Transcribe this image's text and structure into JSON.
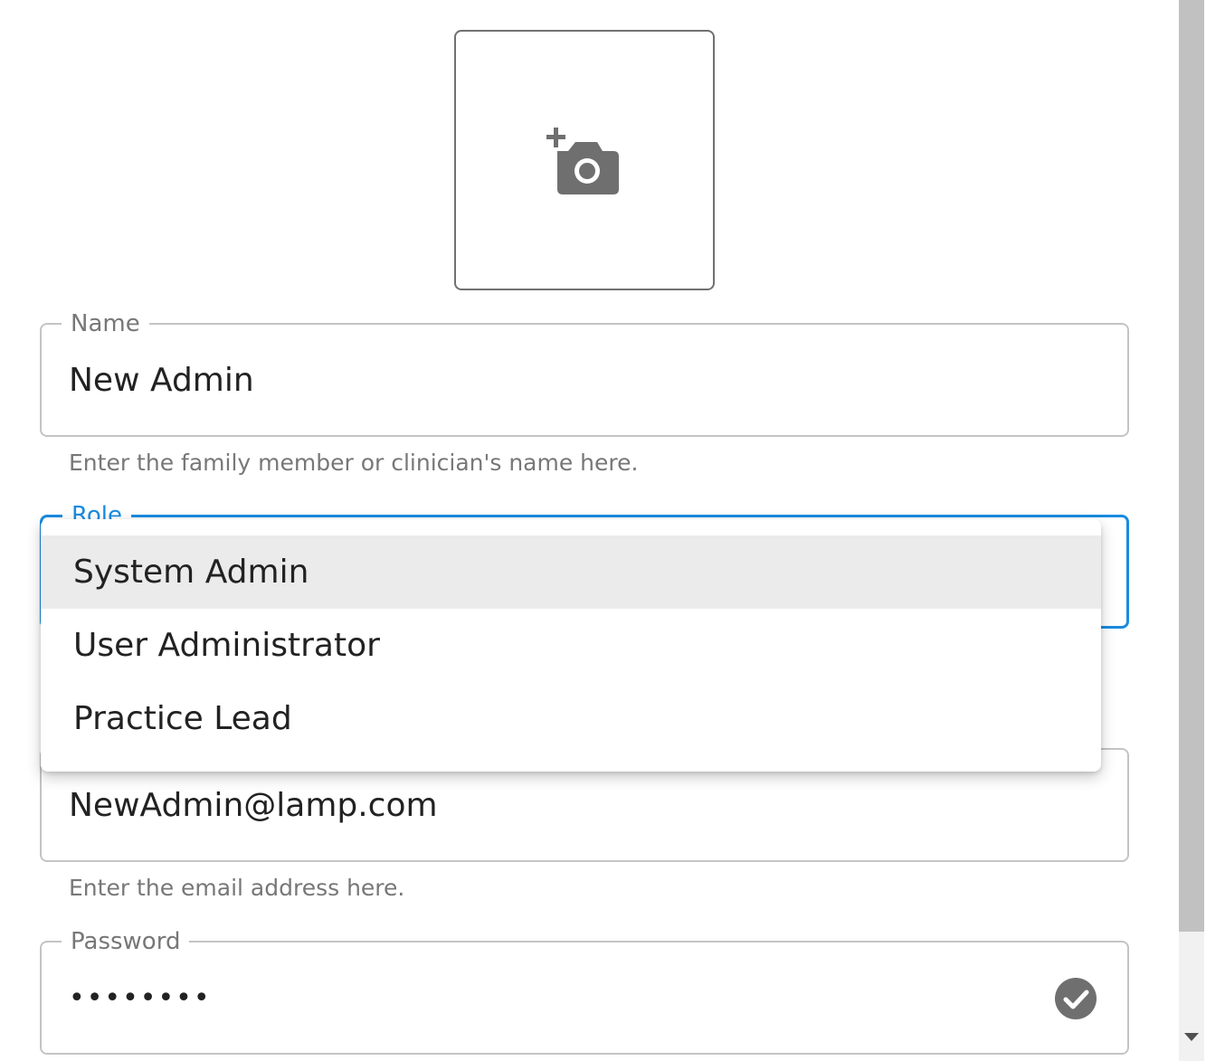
{
  "avatar": {
    "icon": "add-a-photo-icon"
  },
  "name_field": {
    "label": "Name",
    "value": "New Admin",
    "helper": "Enter the family member or clinician's name here."
  },
  "role_field": {
    "label": "Role",
    "menu": {
      "options": [
        "System Admin",
        "User Administrator",
        "Practice Lead"
      ],
      "highlighted": "System Admin"
    }
  },
  "email_field": {
    "value": "NewAdmin@lamp.com",
    "helper": "Enter the email address here."
  },
  "password_field": {
    "label": "Password",
    "value": "••••••••",
    "status_icon": "check-circle-icon"
  },
  "colors": {
    "focus": "#1a8be0",
    "border": "#c4c4c4",
    "muted_text": "#777777",
    "icon": "#6f6f6f",
    "menu_highlight": "#ebebeb"
  }
}
